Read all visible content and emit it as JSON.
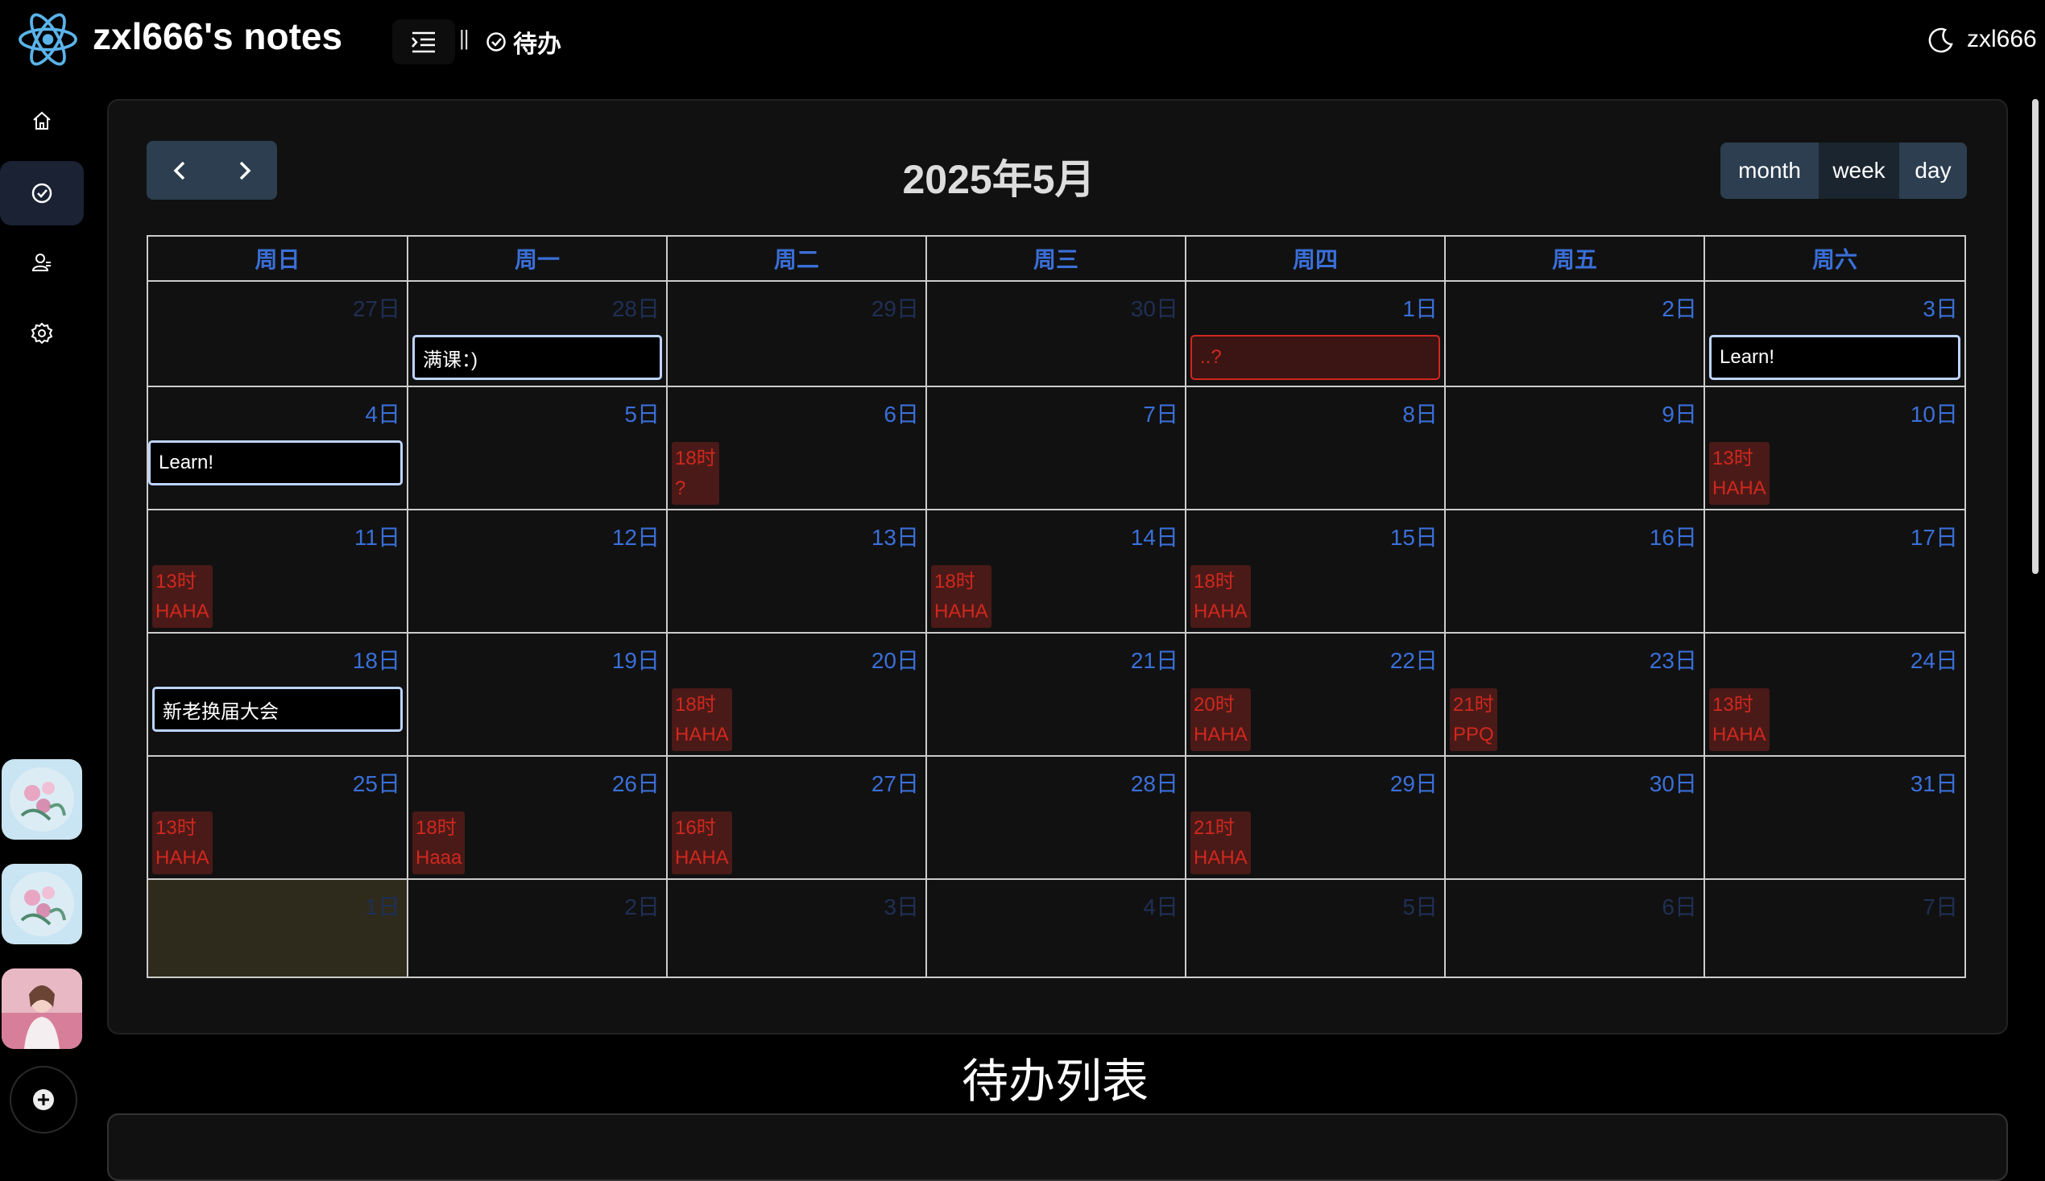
{
  "header": {
    "app_title": "zxl666's notes",
    "breadcrumb_sep": "||",
    "breadcrumb_label": "待办",
    "user_name": "zxl666"
  },
  "sidebar": {
    "items": [
      {
        "icon": "home-icon",
        "active": false
      },
      {
        "icon": "check-circle-icon",
        "active": true
      },
      {
        "icon": "user-icon",
        "active": false
      },
      {
        "icon": "gear-icon",
        "active": false
      }
    ]
  },
  "calendar": {
    "title": "2025年5月",
    "views": [
      "month",
      "week",
      "day"
    ],
    "active_view": "week",
    "weekdays": [
      "周日",
      "周一",
      "周二",
      "周三",
      "周四",
      "周五",
      "周六"
    ],
    "days": [
      [
        "27日",
        "28日",
        "29日",
        "30日",
        "1日",
        "2日",
        "3日"
      ],
      [
        "4日",
        "5日",
        "6日",
        "7日",
        "8日",
        "9日",
        "10日"
      ],
      [
        "11日",
        "12日",
        "13日",
        "14日",
        "15日",
        "16日",
        "17日"
      ],
      [
        "18日",
        "19日",
        "20日",
        "21日",
        "22日",
        "23日",
        "24日"
      ],
      [
        "25日",
        "26日",
        "27日",
        "28日",
        "29日",
        "30日",
        "31日"
      ],
      [
        "1日",
        "2日",
        "3日",
        "4日",
        "5日",
        "6日",
        "7日"
      ]
    ],
    "events": [
      {
        "id": "e1",
        "text": "满课：)"
      },
      {
        "id": "e2",
        "text": "..?"
      },
      {
        "id": "e3",
        "text": "Learn!"
      },
      {
        "id": "e4",
        "text": "Learn!"
      },
      {
        "id": "e5",
        "time": "18时",
        "text": "?"
      },
      {
        "id": "e6",
        "time": "13时",
        "text": "HAHA"
      },
      {
        "id": "e7",
        "time": "13时",
        "text": "HAHA"
      },
      {
        "id": "e8",
        "time": "18时",
        "text": "HAHA"
      },
      {
        "id": "e9",
        "time": "18时",
        "text": "HAHA"
      },
      {
        "id": "e10",
        "text": "新老换届大会"
      },
      {
        "id": "e11",
        "time": "18时",
        "text": "HAHA"
      },
      {
        "id": "e12",
        "time": "20时",
        "text": "HAHA"
      },
      {
        "id": "e13",
        "time": "21时",
        "text": "PPQ"
      },
      {
        "id": "e14",
        "time": "13时",
        "text": "HAHA"
      },
      {
        "id": "e15",
        "time": "13时",
        "text": "HAHA"
      },
      {
        "id": "e16",
        "time": "18时",
        "text": "Haaa"
      },
      {
        "id": "e17",
        "time": "16时",
        "text": "HAHA"
      },
      {
        "id": "e18",
        "time": "21时",
        "text": "HAHA"
      }
    ]
  },
  "todo": {
    "title": "待办列表"
  },
  "colors": {
    "accent_blue": "#3a6fd8",
    "event_red": "#d0281e",
    "event_border": "#bcd4ff",
    "button_bg": "#2c3e50"
  }
}
